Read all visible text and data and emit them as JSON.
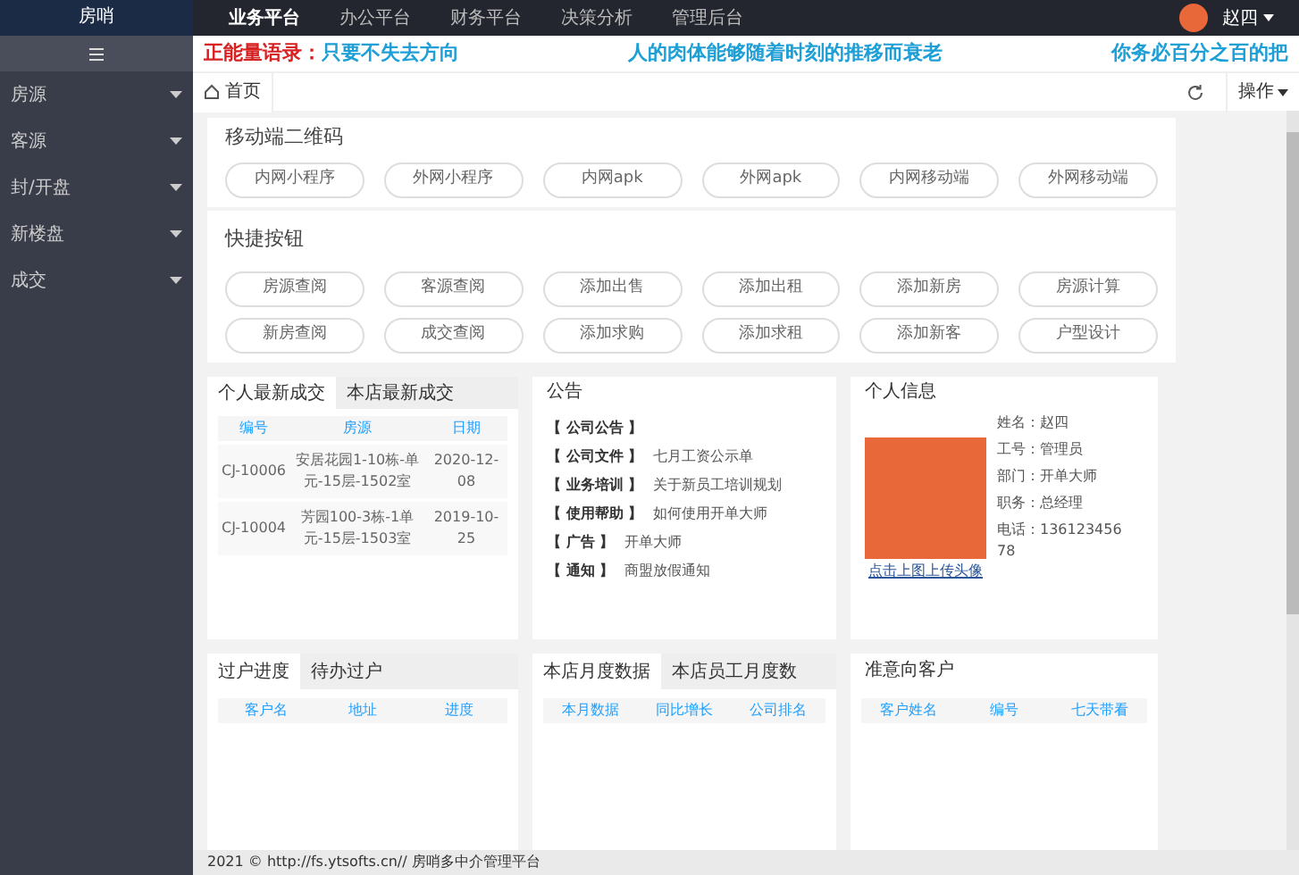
{
  "top_bar": {
    "logo": "房哨",
    "nav": [
      {
        "label": "业务平台",
        "selected": true
      },
      {
        "label": "办公平台",
        "selected": false
      },
      {
        "label": "财务平台",
        "selected": false
      },
      {
        "label": "决策分析",
        "selected": false
      },
      {
        "label": "管理后台",
        "selected": false
      }
    ],
    "user": "赵四"
  },
  "sidebar": {
    "items": [
      "房源",
      "客源",
      "封/开盘",
      "新楼盘",
      "成交"
    ]
  },
  "motto": {
    "label": "正能量语录：",
    "phrases": [
      "只要不失去方向",
      "人的肉体能够随着时刻的推移而衰老",
      "你务必百分之百的把"
    ]
  },
  "tabs": [
    {
      "label": "首页",
      "selected": true
    }
  ],
  "actions_label": "操作",
  "qr_section": {
    "title": "移动端二维码",
    "buttons": [
      "内网小程序",
      "外网小程序",
      "内网apk",
      "外网apk",
      "内网移动端",
      "外网移动端"
    ]
  },
  "quick_section": {
    "title": "快捷按钮",
    "buttons": [
      "房源查阅",
      "客源查阅",
      "添加出售",
      "添加出租",
      "添加新房",
      "房源计算",
      "新房查阅",
      "成交查阅",
      "添加求购",
      "添加求租",
      "添加新客",
      "户型设计"
    ]
  },
  "deals_card": {
    "tabs": [
      {
        "label": "个人最新成交",
        "selected": true
      },
      {
        "label": "本店最新成交",
        "selected": false
      }
    ],
    "columns": [
      "编号",
      "房源",
      "日期"
    ],
    "rows": [
      [
        "CJ-10006",
        "安居花园1-10栋-单元-15层-1502室",
        "2020-12-08"
      ],
      [
        "CJ-10004",
        "芳园100-3栋-1单元-15层-1503室",
        "2019-10-25"
      ]
    ]
  },
  "notice_card": {
    "title": "公告",
    "items": [
      {
        "tag": "【 公司公告 】"
      },
      {
        "tag": "【 公司文件 】",
        "text": "七月工资公示单"
      },
      {
        "tag": "【 业务培训 】",
        "text": "关于新员工培训规划"
      },
      {
        "tag": "【 使用帮助 】",
        "text": "如何使用开单大师"
      },
      {
        "tag": "【 广告 】",
        "text": "开单大师"
      },
      {
        "tag": "【 通知 】",
        "text": "商盟放假通知"
      }
    ]
  },
  "profile_card": {
    "title": "个人信息",
    "upload_link": "点击上图上传头像",
    "fields": [
      "姓名：赵四",
      "工号：管理员",
      "部门：开单大师",
      "职务：总经理",
      "电话：13612345678"
    ]
  },
  "transfer_card": {
    "tabs": [
      {
        "label": "过户进度",
        "selected": true
      },
      {
        "label": "待办过户",
        "selected": false
      }
    ],
    "columns": [
      "客户名",
      "地址",
      "进度"
    ]
  },
  "monthly_card": {
    "tabs": [
      {
        "label": "本店月度数据",
        "selected": true
      },
      {
        "label": "本店员工月度数",
        "selected": false
      }
    ],
    "columns": [
      "本月数据",
      "同比增长",
      "公司排名"
    ]
  },
  "clients_card": {
    "title": "准意向客户",
    "columns": [
      "客户姓名",
      "编号",
      "七天带看"
    ]
  },
  "footer": "2021 © http://fs.ytsofts.cn// 房哨多中介管理平台"
}
